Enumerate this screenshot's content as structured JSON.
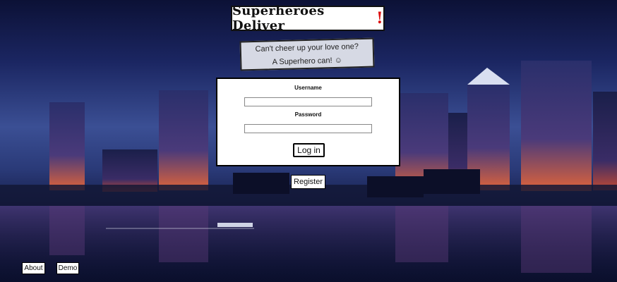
{
  "app": {
    "title": "Superheroes Deliver",
    "title_bang": "!"
  },
  "tagline": {
    "line1": "Can't cheer up your love one?",
    "line2": "A Superhero can!",
    "emoji": "☺"
  },
  "login": {
    "username_label": "Username",
    "username_value": "",
    "password_label": "Password",
    "password_value": "",
    "login_label": "Log in"
  },
  "register_label": "Register",
  "footer": {
    "about_label": "About",
    "demo_label": "Demo"
  },
  "colors": {
    "title_accent": "#d11111"
  }
}
